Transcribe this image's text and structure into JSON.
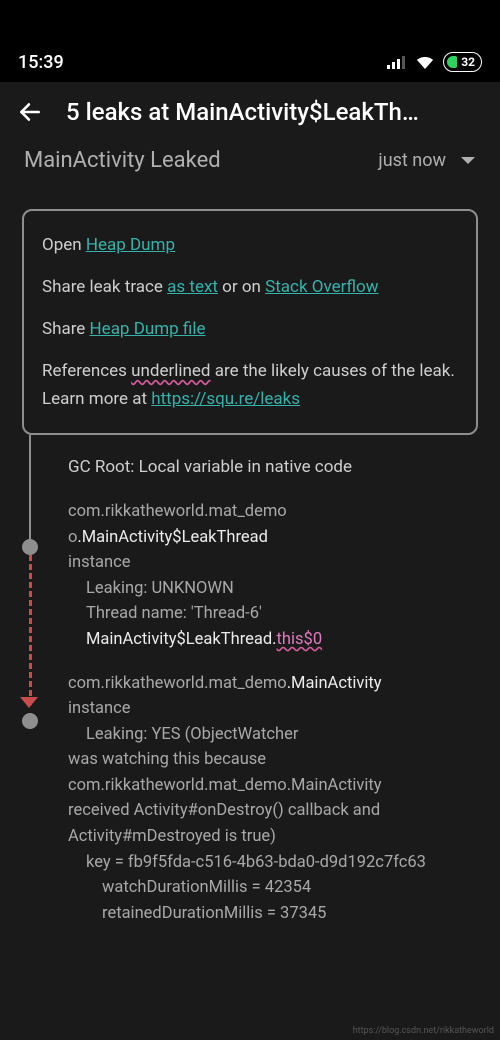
{
  "statusbar": {
    "time": "15:39",
    "battery_pct": "32"
  },
  "appbar": {
    "title": "5 leaks at MainActivity$LeakTh…"
  },
  "header": {
    "subtitle": "MainActivity Leaked",
    "dropdown_selected": "just now"
  },
  "infobox": {
    "open_prefix": "Open ",
    "heap_dump_link": "Heap Dump",
    "share_trace_prefix": "Share leak trace ",
    "as_text_link": "as text",
    "or_on": " or on ",
    "so_link": "Stack Overflow",
    "share_file_prefix": "Share ",
    "heap_file_link": "Heap Dump file",
    "ref_prefix": "References ",
    "underlined_word": "underlined",
    "ref_mid": " are the likely causes of the leak. Learn more at ",
    "learn_link": "https://squ.re/leaks"
  },
  "trace": {
    "gc_root": "GC Root: Local variable in native code",
    "entry1": {
      "line1_pkg": "com.rikkatheworld.mat_demo",
      "line1_class": ".MainActivity$LeakThread",
      "instance": "instance",
      "leaking": "Leaking: UNKNOWN",
      "thread": "Thread name: 'Thread-6'",
      "ref_prefix": "MainActivity$LeakThread.",
      "ref_field": "this$0"
    },
    "entry2": {
      "pkg": "com.rikkatheworld.mat_demo",
      "class": ".MainActivity",
      "instance": "instance",
      "leaking_a": "Leaking: YES (ObjectWatcher",
      "l2": "was watching this because",
      "l3": "com.rikkatheworld.mat_demo.MainActivity",
      "l4": "received Activity#onDestroy() callback and",
      "l5": "Activity#mDestroyed is true)",
      "key": "key = fb9f5fda-c516-4b63-bda0-d9d192c7fc63",
      "watch": "watchDurationMillis = 42354",
      "retained": "retainedDurationMillis = 37345"
    }
  },
  "watermark": "https://blog.csdn.net/rikkatheworld"
}
